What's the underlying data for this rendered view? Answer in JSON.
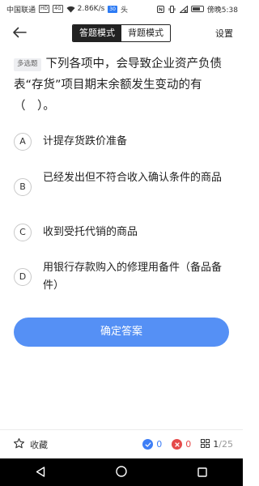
{
  "status_bar": {
    "carrier": "中国联通",
    "carrier_chip": "HD",
    "network_chip": "4G",
    "speed": "2.86K/s",
    "app_chip": "30",
    "extra_icon": "头",
    "time": "傍晚5:38",
    "battery_level": 0.8
  },
  "nav": {
    "back_icon": "back-arrow-icon",
    "tabs": [
      "答题模式",
      "背题模式"
    ],
    "active_tab": "答题模式",
    "settings_label": "设置"
  },
  "question": {
    "type_badge": "多选题",
    "text": "下列各项中，会导致企业资产负债表“存货”项目期末余额发生变动的有（　）。"
  },
  "options": [
    {
      "letter": "A",
      "text": "计提存货跌价准备"
    },
    {
      "letter": "B",
      "text": "已经发出但不符合收入确认条件的商品"
    },
    {
      "letter": "C",
      "text": "收到受托代销的商品"
    },
    {
      "letter": "D",
      "text": "用银行存款购入的修理用备件（备品备件）"
    }
  ],
  "submit_label": "确定答案",
  "toolbar": {
    "favorite_label": "收藏",
    "correct_count": "0",
    "wrong_count": "0",
    "current": "1",
    "total": "/25"
  },
  "colors": {
    "accent": "#5590f5",
    "correct": "#3d7ef6",
    "wrong": "#e54a4a"
  }
}
